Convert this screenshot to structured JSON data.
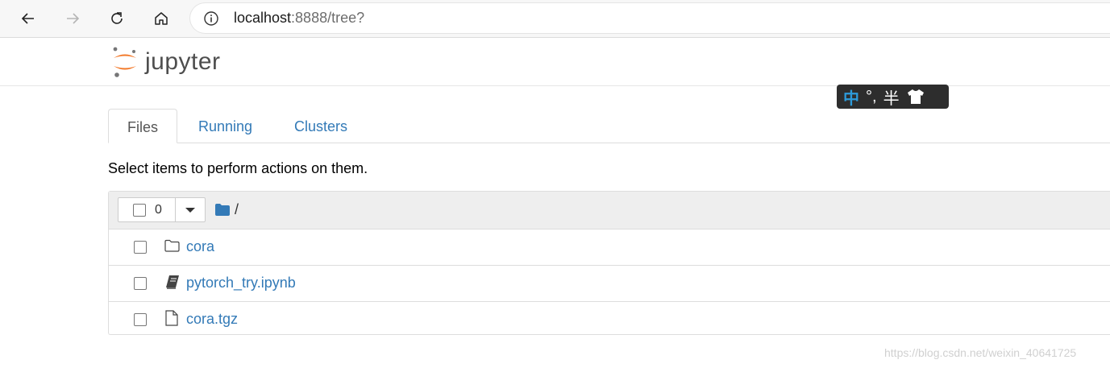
{
  "browser": {
    "url_host": "localhost",
    "url_rest": ":8888/tree?"
  },
  "app": {
    "logo_text": "jupyter"
  },
  "ime": {
    "mode": "中",
    "punct": "°,",
    "width": "半"
  },
  "tabs": [
    {
      "label": "Files",
      "active": true
    },
    {
      "label": "Running",
      "active": false
    },
    {
      "label": "Clusters",
      "active": false
    }
  ],
  "hint": "Select items to perform actions on them.",
  "toolbar": {
    "selected_count": "0",
    "breadcrumb": "/"
  },
  "files": [
    {
      "name": "cora",
      "icon": "folder-icon"
    },
    {
      "name": "pytorch_try.ipynb",
      "icon": "notebook-icon"
    },
    {
      "name": "cora.tgz",
      "icon": "file-icon"
    }
  ],
  "watermark": "https://blog.csdn.net/weixin_40641725",
  "colors": {
    "link": "#337ab7",
    "logo_orange": "#f37726"
  }
}
